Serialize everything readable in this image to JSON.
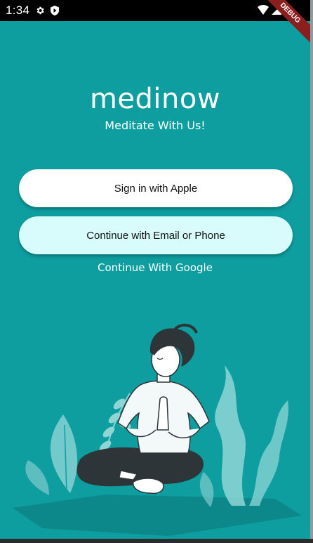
{
  "status_bar": {
    "time": "1:34",
    "icons": [
      "gear-icon",
      "shield-icon",
      "wifi-icon",
      "signal-icon",
      "battery-icon"
    ]
  },
  "debug_banner": "DEBUG",
  "app": {
    "title": "medinow",
    "subtitle": "Meditate With Us!"
  },
  "buttons": {
    "apple": "Sign in with Apple",
    "email": "Continue with Email or Phone",
    "google": "Continue With Google"
  },
  "colors": {
    "background": "#0E9EA0",
    "button_primary": "#FFFFFF",
    "button_secondary": "#D8FBFB",
    "text_on_background": "#FFFFFF",
    "debug_ribbon": "#8B1E1E"
  },
  "illustration": "meditating-person-illustration"
}
